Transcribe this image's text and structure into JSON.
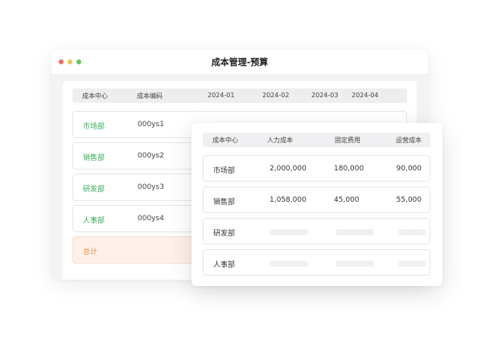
{
  "colors": {
    "red_dot": "#f26b5b",
    "yellow_dot": "#f5bf4f",
    "green_dot": "#62c554",
    "dept_green": "#3aab5a",
    "total_orange": "#e9893c"
  },
  "back_window": {
    "title": "成本管理-预算",
    "columns": [
      "成本中心",
      "成本编码",
      "2024-01",
      "2024-02",
      "2024-03",
      "2024-04"
    ],
    "rows": [
      {
        "name": "市场部",
        "code": "000ys1"
      },
      {
        "name": "销售部",
        "code": "000ys2"
      },
      {
        "name": "研发部",
        "code": "000ys3"
      },
      {
        "name": "人事部",
        "code": "000ys4"
      }
    ],
    "total_label": "总计"
  },
  "front_window": {
    "columns": [
      "成本中心",
      "人力成本",
      "固定费用",
      "运营成本"
    ],
    "rows": [
      {
        "name": "市场部",
        "labor": "2,000,000",
        "fixed": "180,000",
        "ops": "90,000"
      },
      {
        "name": "销售部",
        "labor": "1,058,000",
        "fixed": "45,000",
        "ops": "55,000"
      },
      {
        "name": "研发部"
      },
      {
        "name": "人事部"
      }
    ]
  }
}
